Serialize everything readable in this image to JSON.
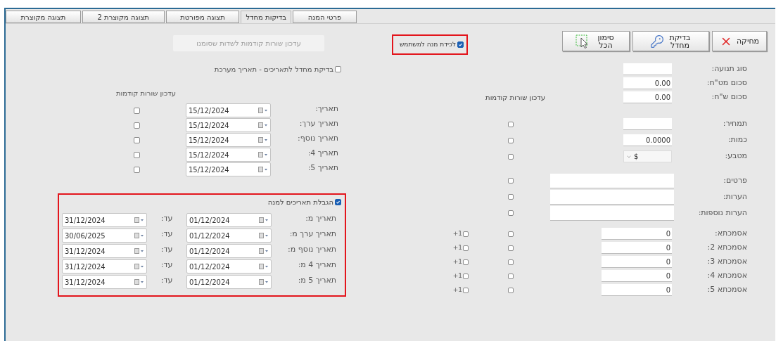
{
  "tabs": [
    {
      "label": "פרטי המנה",
      "selected": false
    },
    {
      "label": "בדיקות מחדל",
      "selected": true
    },
    {
      "label": "תצוגה מפורטת",
      "selected": false
    },
    {
      "label": "תצוגה מקוצרת 2",
      "selected": false
    },
    {
      "label": "תצוגה מקוצרת",
      "selected": false
    }
  ],
  "toolbar": {
    "buttons": [
      {
        "label": "מחיקה"
      },
      {
        "label": "בדיקת מחדל"
      },
      {
        "label": "סימון הכל"
      }
    ],
    "lock_batch": {
      "label": "לכידת מנה למשתמש",
      "checked": true
    },
    "update_button": {
      "label": "עדכון שורות קודמות לשדות שסומנו",
      "disabled": true
    }
  },
  "fields": {
    "update_header": "עדכון שורות קודמות",
    "top": [
      {
        "label": "סוג תנועה:"
      },
      {
        "label": "סכום מט\"ח:",
        "value": "0.00"
      },
      {
        "label": "סכום ש\"ח:",
        "value": "0.00"
      }
    ],
    "middle": [
      {
        "label": "תמחיר:",
        "kind": "text",
        "update": false
      },
      {
        "label": "כמות:",
        "kind": "text",
        "value": "0.0000",
        "update": false
      },
      {
        "label": "מטבע:",
        "kind": "select",
        "value": "$",
        "update": false
      }
    ],
    "notes": [
      {
        "label": "פרטים:",
        "update": false
      },
      {
        "label": "הערות:",
        "update": false
      },
      {
        "label": "הערות נוספות:",
        "update": false
      }
    ],
    "references": [
      {
        "label": "אסמכתא:",
        "value": "0",
        "update": false,
        "plus_label": "+1",
        "plus": false
      },
      {
        "label": "אסמכתא 2:",
        "value": "0",
        "update": false,
        "plus_label": "+1",
        "plus": false
      },
      {
        "label": "אסמכתא 3:",
        "value": "0",
        "update": false,
        "plus_label": "+1",
        "plus": false
      },
      {
        "label": "אסמכתא 4:",
        "value": "0",
        "update": false,
        "plus_label": "+1",
        "plus": false
      },
      {
        "label": "אסמכתא 5:",
        "value": "0",
        "update": false,
        "plus_label": "+1",
        "plus": false
      }
    ]
  },
  "dates": {
    "default_check": {
      "label": "בדיקת מחדל לתאריכים - תאריך מערכת",
      "checked": false
    },
    "update_header": "עדכון שורות קודמות",
    "rows": [
      {
        "label": "תאריך:",
        "value": "15/12/2024",
        "update": false
      },
      {
        "label": "תאריך ערך:",
        "value": "15/12/2024",
        "update": false
      },
      {
        "label": "תאריך נוסף:",
        "value": "15/12/2024",
        "update": false
      },
      {
        "label": "תאריך 4:",
        "value": "15/12/2024",
        "update": false
      },
      {
        "label": "תאריך 5:",
        "value": "15/12/2024",
        "update": false
      }
    ]
  },
  "date_limits": {
    "label": "הגבלת תאריכים למנה",
    "checked": true,
    "rows": [
      {
        "label": "תאריך מ:",
        "from": "01/12/2024",
        "to_label": "עד:",
        "to": "31/12/2024"
      },
      {
        "label": "תאריך ערך מ:",
        "from": "01/12/2024",
        "to_label": "עד:",
        "to": "30/06/2025"
      },
      {
        "label": "תאריך נוסף מ:",
        "from": "01/12/2024",
        "to_label": "עד:",
        "to": "31/12/2024"
      },
      {
        "label": "תאריך 4 מ:",
        "from": "01/12/2024",
        "to_label": "עד:",
        "to": "31/12/2024"
      },
      {
        "label": "תאריך 5 מ:",
        "from": "01/12/2024",
        "to_label": "עד:",
        "to": "31/12/2024"
      }
    ]
  }
}
